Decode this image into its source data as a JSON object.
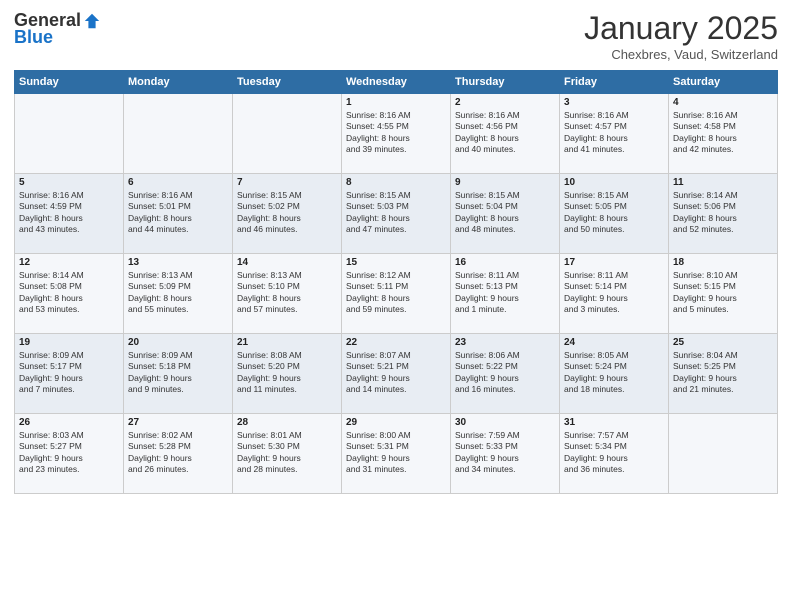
{
  "logo": {
    "general": "General",
    "blue": "Blue"
  },
  "header": {
    "month": "January 2025",
    "location": "Chexbres, Vaud, Switzerland"
  },
  "days_of_week": [
    "Sunday",
    "Monday",
    "Tuesday",
    "Wednesday",
    "Thursday",
    "Friday",
    "Saturday"
  ],
  "weeks": [
    [
      {
        "day": "",
        "info": ""
      },
      {
        "day": "",
        "info": ""
      },
      {
        "day": "",
        "info": ""
      },
      {
        "day": "1",
        "info": "Sunrise: 8:16 AM\nSunset: 4:55 PM\nDaylight: 8 hours\nand 39 minutes."
      },
      {
        "day": "2",
        "info": "Sunrise: 8:16 AM\nSunset: 4:56 PM\nDaylight: 8 hours\nand 40 minutes."
      },
      {
        "day": "3",
        "info": "Sunrise: 8:16 AM\nSunset: 4:57 PM\nDaylight: 8 hours\nand 41 minutes."
      },
      {
        "day": "4",
        "info": "Sunrise: 8:16 AM\nSunset: 4:58 PM\nDaylight: 8 hours\nand 42 minutes."
      }
    ],
    [
      {
        "day": "5",
        "info": "Sunrise: 8:16 AM\nSunset: 4:59 PM\nDaylight: 8 hours\nand 43 minutes."
      },
      {
        "day": "6",
        "info": "Sunrise: 8:16 AM\nSunset: 5:01 PM\nDaylight: 8 hours\nand 44 minutes."
      },
      {
        "day": "7",
        "info": "Sunrise: 8:15 AM\nSunset: 5:02 PM\nDaylight: 8 hours\nand 46 minutes."
      },
      {
        "day": "8",
        "info": "Sunrise: 8:15 AM\nSunset: 5:03 PM\nDaylight: 8 hours\nand 47 minutes."
      },
      {
        "day": "9",
        "info": "Sunrise: 8:15 AM\nSunset: 5:04 PM\nDaylight: 8 hours\nand 48 minutes."
      },
      {
        "day": "10",
        "info": "Sunrise: 8:15 AM\nSunset: 5:05 PM\nDaylight: 8 hours\nand 50 minutes."
      },
      {
        "day": "11",
        "info": "Sunrise: 8:14 AM\nSunset: 5:06 PM\nDaylight: 8 hours\nand 52 minutes."
      }
    ],
    [
      {
        "day": "12",
        "info": "Sunrise: 8:14 AM\nSunset: 5:08 PM\nDaylight: 8 hours\nand 53 minutes."
      },
      {
        "day": "13",
        "info": "Sunrise: 8:13 AM\nSunset: 5:09 PM\nDaylight: 8 hours\nand 55 minutes."
      },
      {
        "day": "14",
        "info": "Sunrise: 8:13 AM\nSunset: 5:10 PM\nDaylight: 8 hours\nand 57 minutes."
      },
      {
        "day": "15",
        "info": "Sunrise: 8:12 AM\nSunset: 5:11 PM\nDaylight: 8 hours\nand 59 minutes."
      },
      {
        "day": "16",
        "info": "Sunrise: 8:11 AM\nSunset: 5:13 PM\nDaylight: 9 hours\nand 1 minute."
      },
      {
        "day": "17",
        "info": "Sunrise: 8:11 AM\nSunset: 5:14 PM\nDaylight: 9 hours\nand 3 minutes."
      },
      {
        "day": "18",
        "info": "Sunrise: 8:10 AM\nSunset: 5:15 PM\nDaylight: 9 hours\nand 5 minutes."
      }
    ],
    [
      {
        "day": "19",
        "info": "Sunrise: 8:09 AM\nSunset: 5:17 PM\nDaylight: 9 hours\nand 7 minutes."
      },
      {
        "day": "20",
        "info": "Sunrise: 8:09 AM\nSunset: 5:18 PM\nDaylight: 9 hours\nand 9 minutes."
      },
      {
        "day": "21",
        "info": "Sunrise: 8:08 AM\nSunset: 5:20 PM\nDaylight: 9 hours\nand 11 minutes."
      },
      {
        "day": "22",
        "info": "Sunrise: 8:07 AM\nSunset: 5:21 PM\nDaylight: 9 hours\nand 14 minutes."
      },
      {
        "day": "23",
        "info": "Sunrise: 8:06 AM\nSunset: 5:22 PM\nDaylight: 9 hours\nand 16 minutes."
      },
      {
        "day": "24",
        "info": "Sunrise: 8:05 AM\nSunset: 5:24 PM\nDaylight: 9 hours\nand 18 minutes."
      },
      {
        "day": "25",
        "info": "Sunrise: 8:04 AM\nSunset: 5:25 PM\nDaylight: 9 hours\nand 21 minutes."
      }
    ],
    [
      {
        "day": "26",
        "info": "Sunrise: 8:03 AM\nSunset: 5:27 PM\nDaylight: 9 hours\nand 23 minutes."
      },
      {
        "day": "27",
        "info": "Sunrise: 8:02 AM\nSunset: 5:28 PM\nDaylight: 9 hours\nand 26 minutes."
      },
      {
        "day": "28",
        "info": "Sunrise: 8:01 AM\nSunset: 5:30 PM\nDaylight: 9 hours\nand 28 minutes."
      },
      {
        "day": "29",
        "info": "Sunrise: 8:00 AM\nSunset: 5:31 PM\nDaylight: 9 hours\nand 31 minutes."
      },
      {
        "day": "30",
        "info": "Sunrise: 7:59 AM\nSunset: 5:33 PM\nDaylight: 9 hours\nand 34 minutes."
      },
      {
        "day": "31",
        "info": "Sunrise: 7:57 AM\nSunset: 5:34 PM\nDaylight: 9 hours\nand 36 minutes."
      },
      {
        "day": "",
        "info": ""
      }
    ]
  ]
}
